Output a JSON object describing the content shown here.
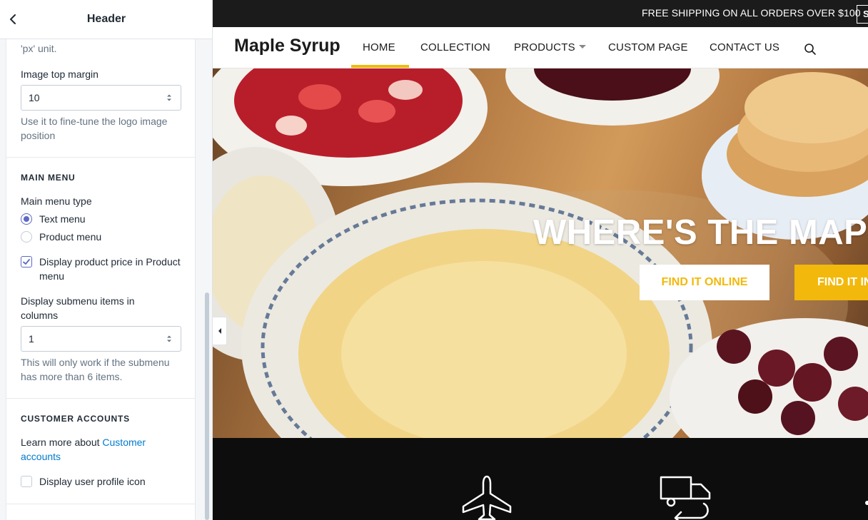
{
  "panel": {
    "title": "Header",
    "logo_help_fragment": "'px' unit.",
    "image_top_margin": {
      "label": "Image top margin",
      "value": "10",
      "help": "Use it to fine-tune the logo image position"
    },
    "main_menu": {
      "section_title": "MAIN MENU",
      "type_label": "Main menu type",
      "options": [
        "Text menu",
        "Product menu"
      ],
      "selected": "Text menu",
      "display_price_label": "Display product price in Product menu",
      "display_price_checked": true,
      "submenu_columns_label": "Display submenu items in columns",
      "submenu_columns_value": "1",
      "submenu_help": "This will only work if the submenu has more than 6 items."
    },
    "customer_accounts": {
      "section_title": "CUSTOMER ACCOUNTS",
      "learn_prefix": "Learn more about ",
      "learn_link": "Customer accounts",
      "profile_icon_label": "Display user profile icon",
      "profile_icon_checked": false
    }
  },
  "store": {
    "announcement": "FREE SHIPPING ON ALL ORDERS OVER $100",
    "announcement_button": "S",
    "logo": "Maple Syrup",
    "nav": [
      "HOME",
      "COLLECTION",
      "PRODUCTS",
      "CUSTOM PAGE",
      "CONTACT US"
    ],
    "active_nav": "HOME",
    "hero": {
      "title": "WHERE'S THE MAPL",
      "button_online": "FIND IT ONLINE",
      "button_store": "FIND IT IN"
    },
    "feature_icons": [
      "airplane-icon",
      "delivery-truck-icon"
    ]
  },
  "colors": {
    "accent": "#f2b90c",
    "selection": "#5c6ac4",
    "link": "#007ace",
    "dark": "#1b1b1b"
  }
}
